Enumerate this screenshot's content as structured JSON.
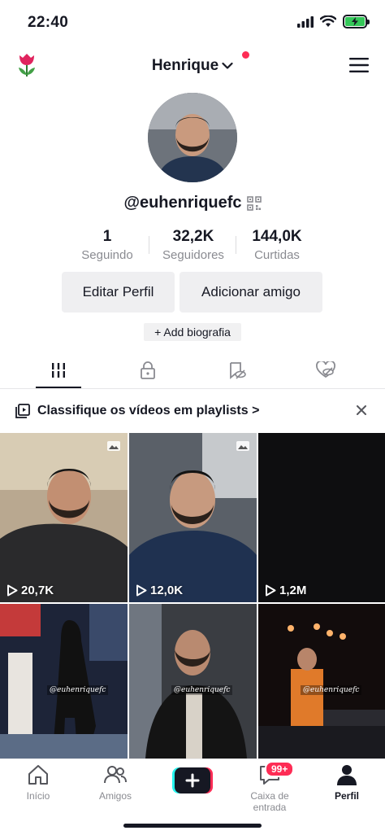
{
  "status_bar": {
    "time": "22:40"
  },
  "header": {
    "title": "Henrique",
    "menu_icon": "hamburger-menu-icon",
    "logo_icon": "tulip-icon"
  },
  "profile": {
    "username": "@euhenriquefc",
    "stats": [
      {
        "value": "1",
        "label": "Seguindo"
      },
      {
        "value": "32,2K",
        "label": "Seguidores"
      },
      {
        "value": "144,0K",
        "label": "Curtidas"
      }
    ],
    "edit_button": "Editar Perfil",
    "add_friend_button": "Adicionar amigo",
    "bio_button": "+ Add biografia"
  },
  "tabs": [
    "videos-grid-icon",
    "lock-icon",
    "hidden-icon",
    "liked-icon"
  ],
  "playlist_banner": {
    "text": "Classifique os vídeos em playlists >"
  },
  "videos": [
    {
      "views": "20,7K",
      "watermark": ""
    },
    {
      "views": "12,0K",
      "watermark": ""
    },
    {
      "views": "1,2M",
      "watermark": ""
    },
    {
      "views": "",
      "watermark": "@euhenriquefc"
    },
    {
      "views": "",
      "watermark": "@euhenriquefc"
    },
    {
      "views": "",
      "watermark": "@euhenriquefc"
    }
  ],
  "bottom_nav": {
    "items": [
      {
        "label": "Início",
        "icon": "home-icon"
      },
      {
        "label": "Amigos",
        "icon": "friends-icon"
      },
      {
        "label": "Caixa de entrada",
        "icon": "inbox-icon"
      },
      {
        "label": "Perfil",
        "icon": "profile-icon"
      }
    ],
    "inbox_badge": "99+"
  },
  "colors": {
    "accent": "#fe2c55",
    "text": "#161823",
    "muted": "#8a8b91",
    "battery": "#34c759"
  }
}
